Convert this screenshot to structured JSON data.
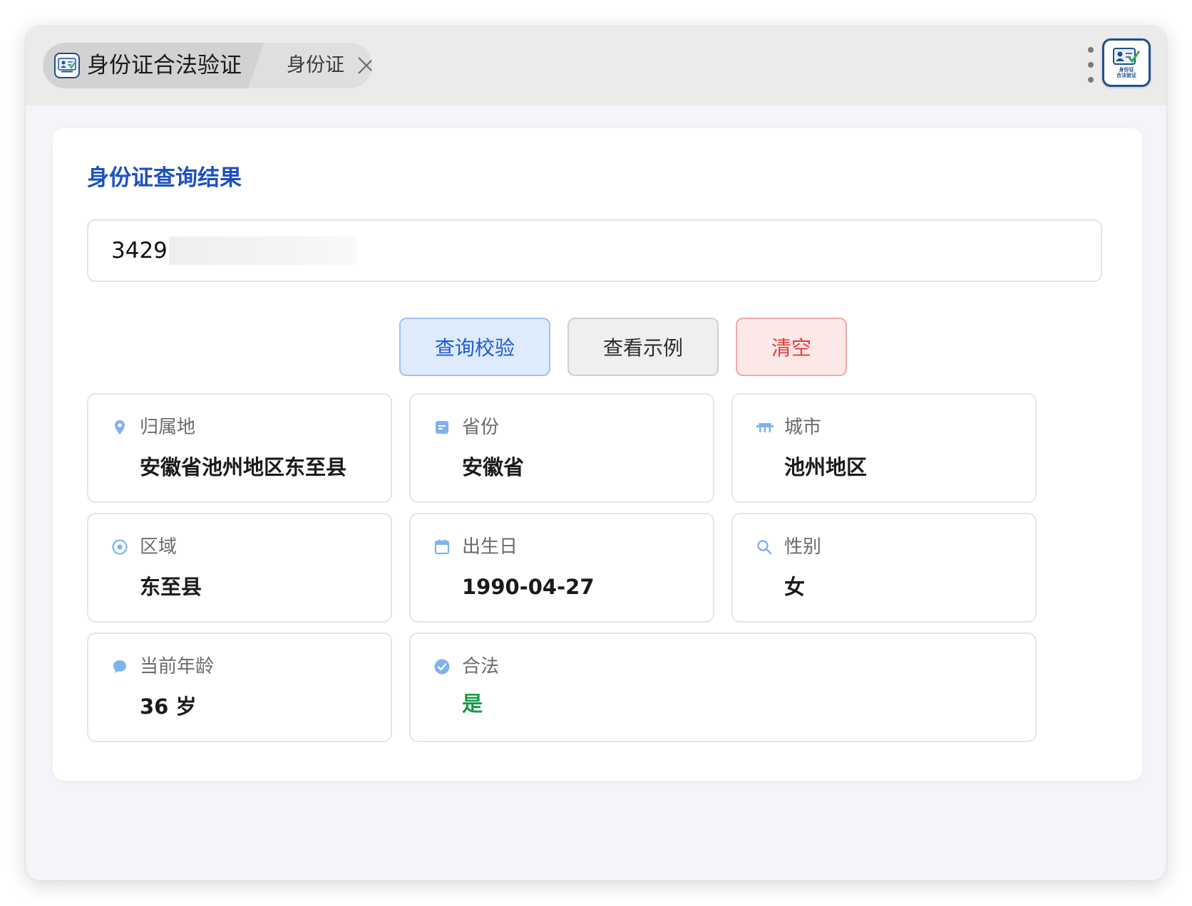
{
  "tab": {
    "title": "身份证合法验证",
    "subtitle": "身份证",
    "icon_text": [
      "身份证",
      "合法验证"
    ]
  },
  "panel": {
    "title": "身份证查询结果",
    "id_value": "3429"
  },
  "buttons": {
    "query": "查询校验",
    "example": "查看示例",
    "clear": "清空"
  },
  "fields": {
    "location": {
      "label": "归属地",
      "value": "安徽省池州地区东至县",
      "icon": "location-pin-icon"
    },
    "province": {
      "label": "省份",
      "value": "安徽省",
      "icon": "document-icon"
    },
    "city": {
      "label": "城市",
      "value": "池州地区",
      "icon": "building-icon"
    },
    "district": {
      "label": "区域",
      "value": "东至县",
      "icon": "target-icon"
    },
    "birthday": {
      "label": "出生日",
      "value": "1990-04-27",
      "icon": "calendar-icon"
    },
    "gender": {
      "label": "性别",
      "value": "女",
      "icon": "search-icon"
    },
    "age": {
      "label": "当前年龄",
      "value": "36 岁",
      "icon": "chat-bubble-icon"
    },
    "legal": {
      "label": "合法",
      "value": "是",
      "icon": "check-circle-icon"
    }
  },
  "colors": {
    "accent": "#1e4fc2",
    "icon_blue": "#7fb2f0",
    "danger": "#e23c3c",
    "success": "#1a9a4a"
  }
}
